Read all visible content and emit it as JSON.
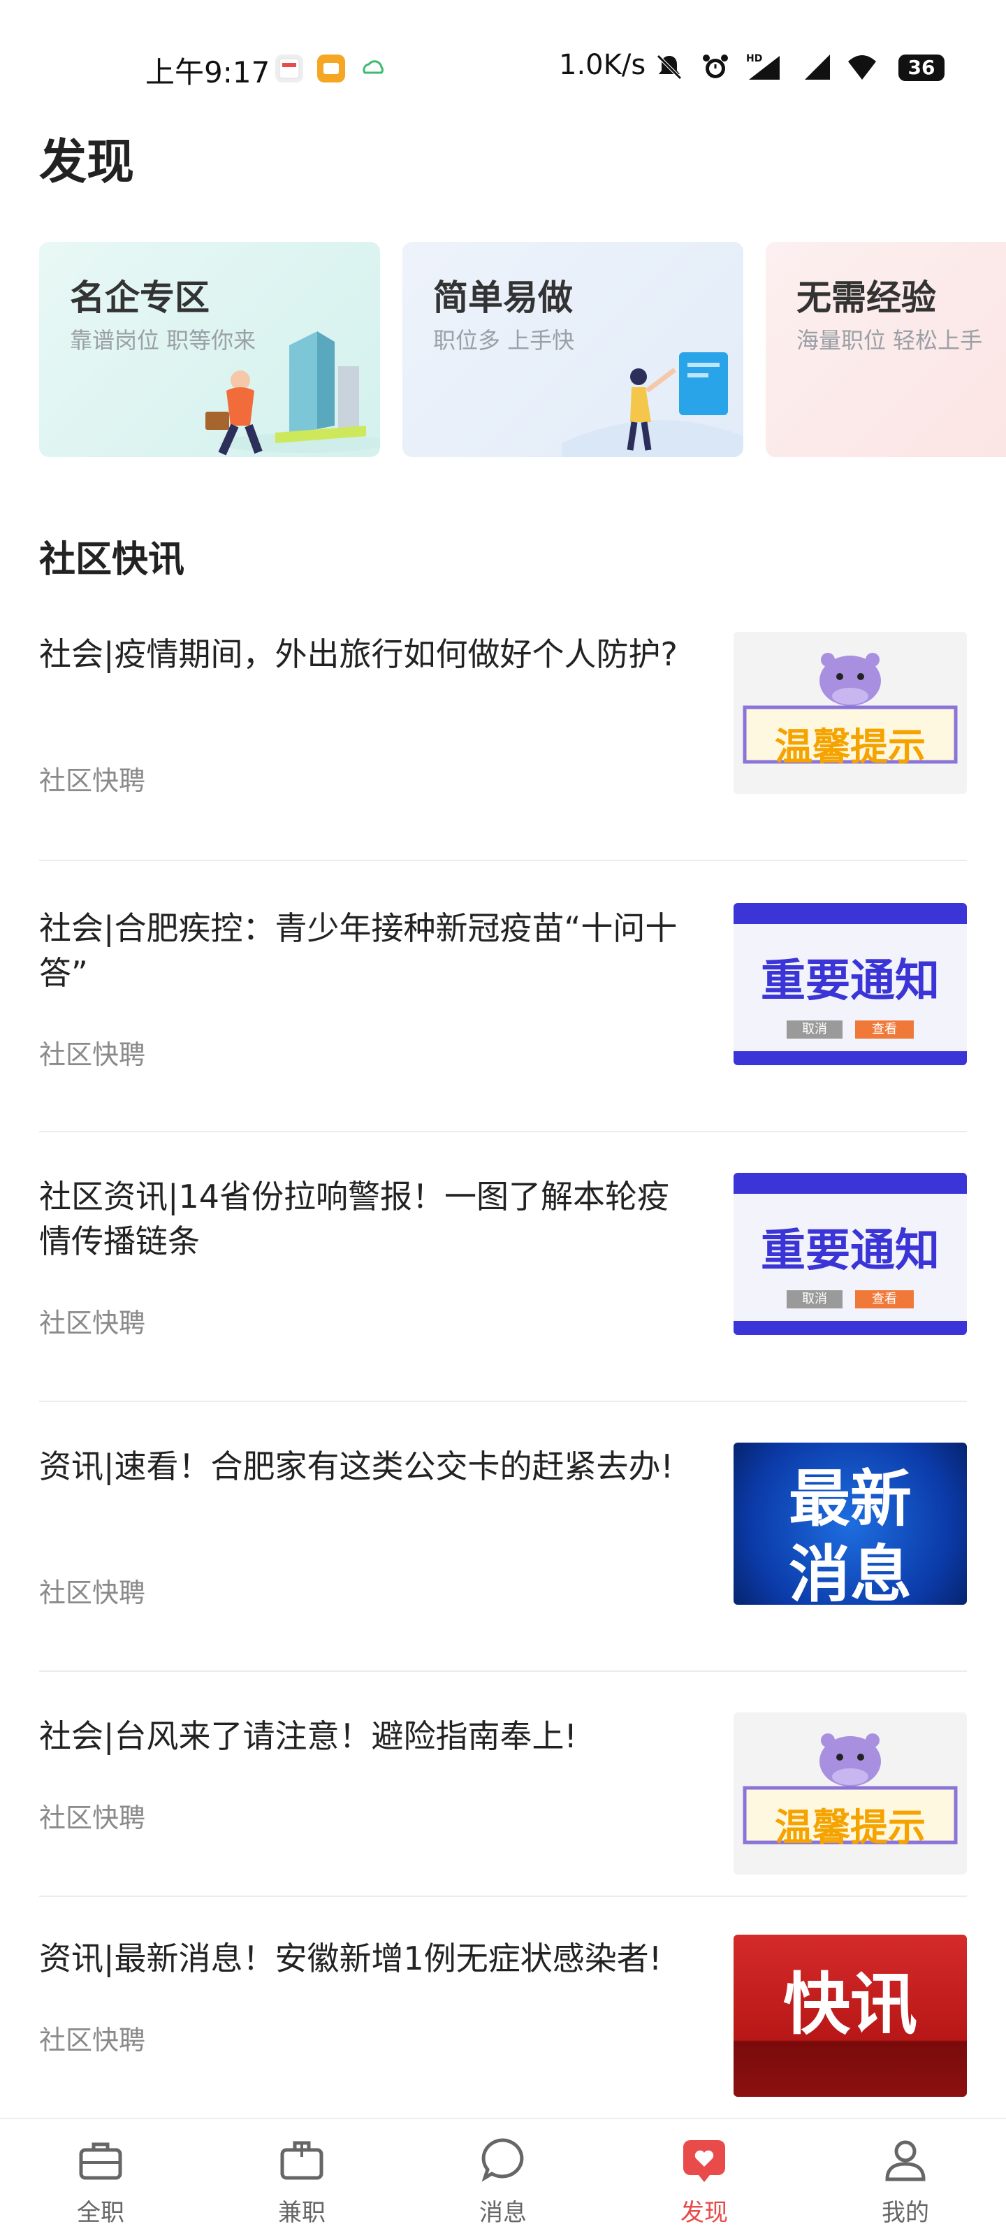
{
  "status_bar": {
    "time": "上午9:17",
    "network_speed": "1.0K/s",
    "hd_label": "HD",
    "battery": "36"
  },
  "page": {
    "title": "发现"
  },
  "categories": [
    {
      "title": "名企专区",
      "subtitle": "靠谱岗位 职等你来",
      "bg": "#dff6f2"
    },
    {
      "title": "简单易做",
      "subtitle": "职位多 上手快",
      "bg": "#e8f0fb"
    },
    {
      "title": "无需经验",
      "subtitle": "海量职位 轻松上手",
      "bg": "#fdeaea"
    }
  ],
  "section": {
    "title": "社区快讯"
  },
  "news": [
    {
      "title": "社会|疫情期间，外出旅行如何做好个人防护?",
      "source": "社区快聘",
      "thumb_type": "tips",
      "thumb_text": "温馨提示"
    },
    {
      "title": "社会|合肥疾控：青少年接种新冠疫苗“十问十答”",
      "source": "社区快聘",
      "thumb_type": "notice",
      "thumb_text": "重要通知",
      "btn_cancel": "取消",
      "btn_view": "查看"
    },
    {
      "title": "社区资讯|14省份拉响警报！一图了解本轮疫情传播链条",
      "source": "社区快聘",
      "thumb_type": "notice",
      "thumb_text": "重要通知",
      "btn_cancel": "取消",
      "btn_view": "查看"
    },
    {
      "title": "资讯|速看！合肥家有这类公交卡的赶紧去办!",
      "source": "社区快聘",
      "thumb_type": "latest",
      "thumb_text_1": "最新",
      "thumb_text_2": "消息"
    },
    {
      "title": "社会|台风来了请注意！避险指南奉上!",
      "source": "社区快聘",
      "thumb_type": "tips",
      "thumb_text": "温馨提示"
    },
    {
      "title": "资讯|最新消息！安徽新增1例无症状感染者!",
      "source": "社区快聘",
      "thumb_type": "flash",
      "thumb_text": "快讯"
    }
  ],
  "bottom_nav": [
    {
      "label": "全职",
      "icon": "briefcase-icon"
    },
    {
      "label": "兼职",
      "icon": "part-time-briefcase-icon"
    },
    {
      "label": "消息",
      "icon": "message-bubble-icon"
    },
    {
      "label": "发现",
      "icon": "heart-chat-icon",
      "active": true
    },
    {
      "label": "我的",
      "icon": "person-icon"
    }
  ],
  "colors": {
    "accent": "#e94a4a",
    "notice_blue": "#3b34d6",
    "tips_orange": "#f5a300"
  }
}
